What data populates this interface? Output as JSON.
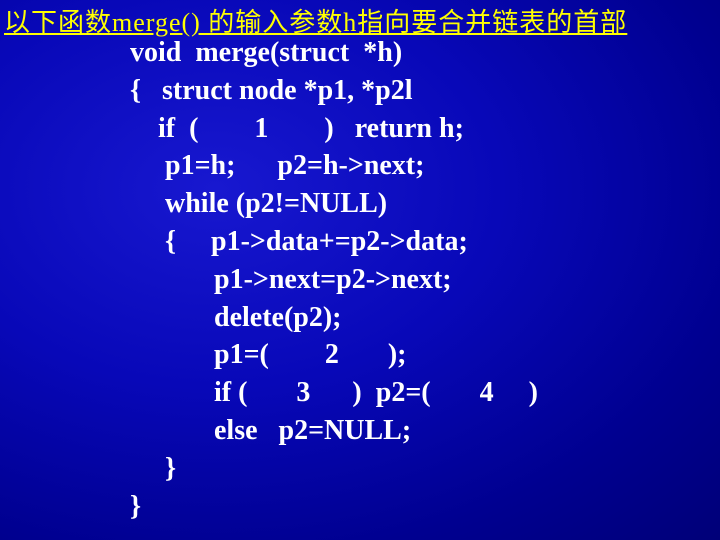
{
  "title": "以下函数merge() 的输入参数h指向要合并链表的首部",
  "code": {
    "l1": "void  merge(struct  *h)",
    "l2": "{   struct node *p1, *p2l",
    "l3": "    if  (        1        )   return h;",
    "l4": "     p1=h;      p2=h->next;",
    "l5": "     while (p2!=NULL)",
    "l6": "     {     p1->data+=p2->data;",
    "l7": "            p1->next=p2->next;",
    "l8": "            delete(p2);",
    "l9": "            p1=(        2       );",
    "l10": "            if (       3      )  p2=(       4     )",
    "l11": "            else   p2=NULL;",
    "l12": "     }",
    "l13": "}"
  }
}
